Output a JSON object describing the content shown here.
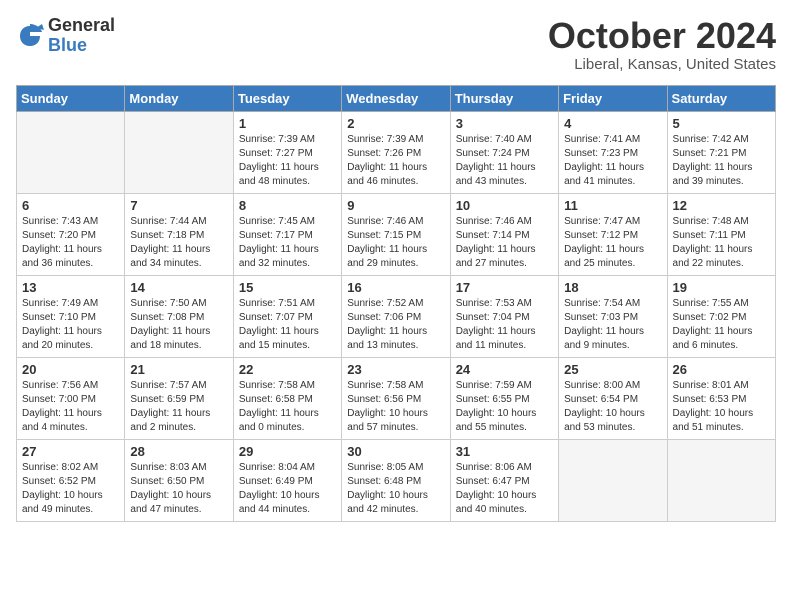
{
  "header": {
    "logo_general": "General",
    "logo_blue": "Blue",
    "month": "October 2024",
    "location": "Liberal, Kansas, United States"
  },
  "weekdays": [
    "Sunday",
    "Monday",
    "Tuesday",
    "Wednesday",
    "Thursday",
    "Friday",
    "Saturday"
  ],
  "weeks": [
    [
      {
        "day": "",
        "empty": true
      },
      {
        "day": "",
        "empty": true
      },
      {
        "day": "1",
        "sunrise": "Sunrise: 7:39 AM",
        "sunset": "Sunset: 7:27 PM",
        "daylight": "Daylight: 11 hours and 48 minutes."
      },
      {
        "day": "2",
        "sunrise": "Sunrise: 7:39 AM",
        "sunset": "Sunset: 7:26 PM",
        "daylight": "Daylight: 11 hours and 46 minutes."
      },
      {
        "day": "3",
        "sunrise": "Sunrise: 7:40 AM",
        "sunset": "Sunset: 7:24 PM",
        "daylight": "Daylight: 11 hours and 43 minutes."
      },
      {
        "day": "4",
        "sunrise": "Sunrise: 7:41 AM",
        "sunset": "Sunset: 7:23 PM",
        "daylight": "Daylight: 11 hours and 41 minutes."
      },
      {
        "day": "5",
        "sunrise": "Sunrise: 7:42 AM",
        "sunset": "Sunset: 7:21 PM",
        "daylight": "Daylight: 11 hours and 39 minutes."
      }
    ],
    [
      {
        "day": "6",
        "sunrise": "Sunrise: 7:43 AM",
        "sunset": "Sunset: 7:20 PM",
        "daylight": "Daylight: 11 hours and 36 minutes."
      },
      {
        "day": "7",
        "sunrise": "Sunrise: 7:44 AM",
        "sunset": "Sunset: 7:18 PM",
        "daylight": "Daylight: 11 hours and 34 minutes."
      },
      {
        "day": "8",
        "sunrise": "Sunrise: 7:45 AM",
        "sunset": "Sunset: 7:17 PM",
        "daylight": "Daylight: 11 hours and 32 minutes."
      },
      {
        "day": "9",
        "sunrise": "Sunrise: 7:46 AM",
        "sunset": "Sunset: 7:15 PM",
        "daylight": "Daylight: 11 hours and 29 minutes."
      },
      {
        "day": "10",
        "sunrise": "Sunrise: 7:46 AM",
        "sunset": "Sunset: 7:14 PM",
        "daylight": "Daylight: 11 hours and 27 minutes."
      },
      {
        "day": "11",
        "sunrise": "Sunrise: 7:47 AM",
        "sunset": "Sunset: 7:12 PM",
        "daylight": "Daylight: 11 hours and 25 minutes."
      },
      {
        "day": "12",
        "sunrise": "Sunrise: 7:48 AM",
        "sunset": "Sunset: 7:11 PM",
        "daylight": "Daylight: 11 hours and 22 minutes."
      }
    ],
    [
      {
        "day": "13",
        "sunrise": "Sunrise: 7:49 AM",
        "sunset": "Sunset: 7:10 PM",
        "daylight": "Daylight: 11 hours and 20 minutes."
      },
      {
        "day": "14",
        "sunrise": "Sunrise: 7:50 AM",
        "sunset": "Sunset: 7:08 PM",
        "daylight": "Daylight: 11 hours and 18 minutes."
      },
      {
        "day": "15",
        "sunrise": "Sunrise: 7:51 AM",
        "sunset": "Sunset: 7:07 PM",
        "daylight": "Daylight: 11 hours and 15 minutes."
      },
      {
        "day": "16",
        "sunrise": "Sunrise: 7:52 AM",
        "sunset": "Sunset: 7:06 PM",
        "daylight": "Daylight: 11 hours and 13 minutes."
      },
      {
        "day": "17",
        "sunrise": "Sunrise: 7:53 AM",
        "sunset": "Sunset: 7:04 PM",
        "daylight": "Daylight: 11 hours and 11 minutes."
      },
      {
        "day": "18",
        "sunrise": "Sunrise: 7:54 AM",
        "sunset": "Sunset: 7:03 PM",
        "daylight": "Daylight: 11 hours and 9 minutes."
      },
      {
        "day": "19",
        "sunrise": "Sunrise: 7:55 AM",
        "sunset": "Sunset: 7:02 PM",
        "daylight": "Daylight: 11 hours and 6 minutes."
      }
    ],
    [
      {
        "day": "20",
        "sunrise": "Sunrise: 7:56 AM",
        "sunset": "Sunset: 7:00 PM",
        "daylight": "Daylight: 11 hours and 4 minutes."
      },
      {
        "day": "21",
        "sunrise": "Sunrise: 7:57 AM",
        "sunset": "Sunset: 6:59 PM",
        "daylight": "Daylight: 11 hours and 2 minutes."
      },
      {
        "day": "22",
        "sunrise": "Sunrise: 7:58 AM",
        "sunset": "Sunset: 6:58 PM",
        "daylight": "Daylight: 11 hours and 0 minutes."
      },
      {
        "day": "23",
        "sunrise": "Sunrise: 7:58 AM",
        "sunset": "Sunset: 6:56 PM",
        "daylight": "Daylight: 10 hours and 57 minutes."
      },
      {
        "day": "24",
        "sunrise": "Sunrise: 7:59 AM",
        "sunset": "Sunset: 6:55 PM",
        "daylight": "Daylight: 10 hours and 55 minutes."
      },
      {
        "day": "25",
        "sunrise": "Sunrise: 8:00 AM",
        "sunset": "Sunset: 6:54 PM",
        "daylight": "Daylight: 10 hours and 53 minutes."
      },
      {
        "day": "26",
        "sunrise": "Sunrise: 8:01 AM",
        "sunset": "Sunset: 6:53 PM",
        "daylight": "Daylight: 10 hours and 51 minutes."
      }
    ],
    [
      {
        "day": "27",
        "sunrise": "Sunrise: 8:02 AM",
        "sunset": "Sunset: 6:52 PM",
        "daylight": "Daylight: 10 hours and 49 minutes."
      },
      {
        "day": "28",
        "sunrise": "Sunrise: 8:03 AM",
        "sunset": "Sunset: 6:50 PM",
        "daylight": "Daylight: 10 hours and 47 minutes."
      },
      {
        "day": "29",
        "sunrise": "Sunrise: 8:04 AM",
        "sunset": "Sunset: 6:49 PM",
        "daylight": "Daylight: 10 hours and 44 minutes."
      },
      {
        "day": "30",
        "sunrise": "Sunrise: 8:05 AM",
        "sunset": "Sunset: 6:48 PM",
        "daylight": "Daylight: 10 hours and 42 minutes."
      },
      {
        "day": "31",
        "sunrise": "Sunrise: 8:06 AM",
        "sunset": "Sunset: 6:47 PM",
        "daylight": "Daylight: 10 hours and 40 minutes."
      },
      {
        "day": "",
        "empty": true
      },
      {
        "day": "",
        "empty": true
      }
    ]
  ]
}
